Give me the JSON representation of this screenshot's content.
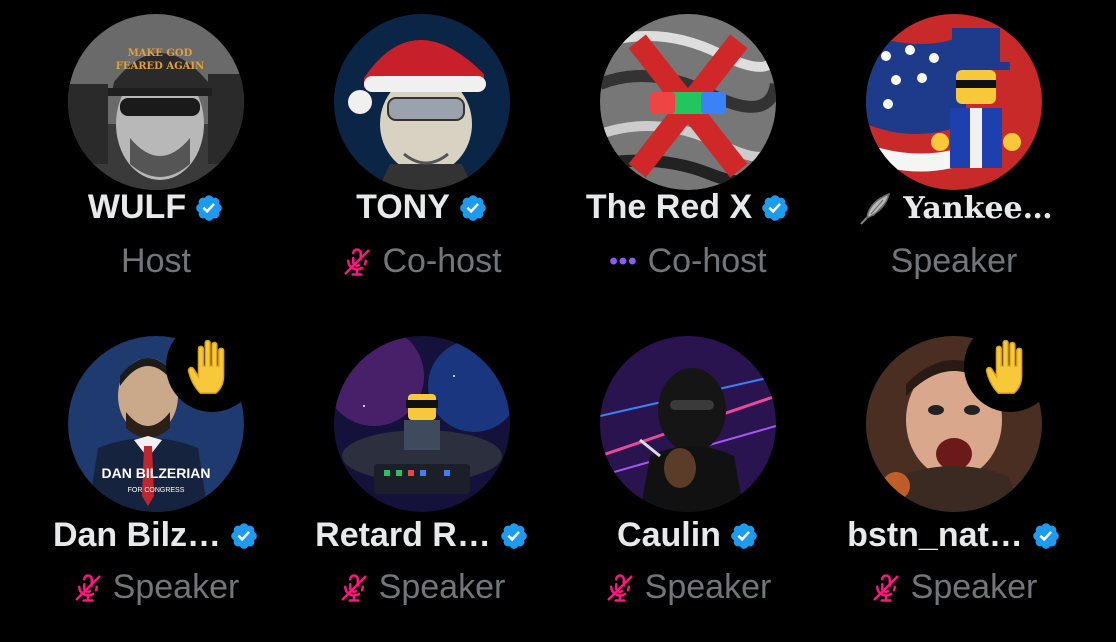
{
  "participants": [
    {
      "name": "WULF",
      "role": "Host",
      "verified": true,
      "muted": false,
      "hand_raised": false,
      "avatar_caption": "MAKE GOD FEARED AGAIN"
    },
    {
      "name": "TONY",
      "role": "Co-host",
      "verified": true,
      "muted": true,
      "hand_raised": false
    },
    {
      "name": "The Red X",
      "role": "Co-host",
      "verified": true,
      "muted": false,
      "speaking_indicator": "•••",
      "hand_raised": false
    },
    {
      "name": "Yankee…",
      "role": "Speaker",
      "verified": false,
      "muted": false,
      "name_icon": "feather-icon",
      "hand_raised": false
    },
    {
      "name": "Dan Bilz…",
      "role": "Speaker",
      "verified": true,
      "muted": true,
      "hand_raised": true,
      "avatar_caption": "DAN BILZERIAN",
      "avatar_subcaption": "FOR CONGRESS"
    },
    {
      "name": "Retard R…",
      "role": "Speaker",
      "verified": true,
      "muted": true,
      "hand_raised": false
    },
    {
      "name": "Caulin",
      "role": "Speaker",
      "verified": true,
      "muted": true,
      "hand_raised": false
    },
    {
      "name": "bstn_nat…",
      "role": "Speaker",
      "verified": true,
      "muted": true,
      "hand_raised": true
    }
  ],
  "colors": {
    "background": "#000000",
    "name_text": "#e7e9ea",
    "role_text": "#71767b",
    "verified_blue": "#1d9bf0",
    "mic_off_pink": "#f91880",
    "speaking_dots": "#8b5cf6"
  }
}
